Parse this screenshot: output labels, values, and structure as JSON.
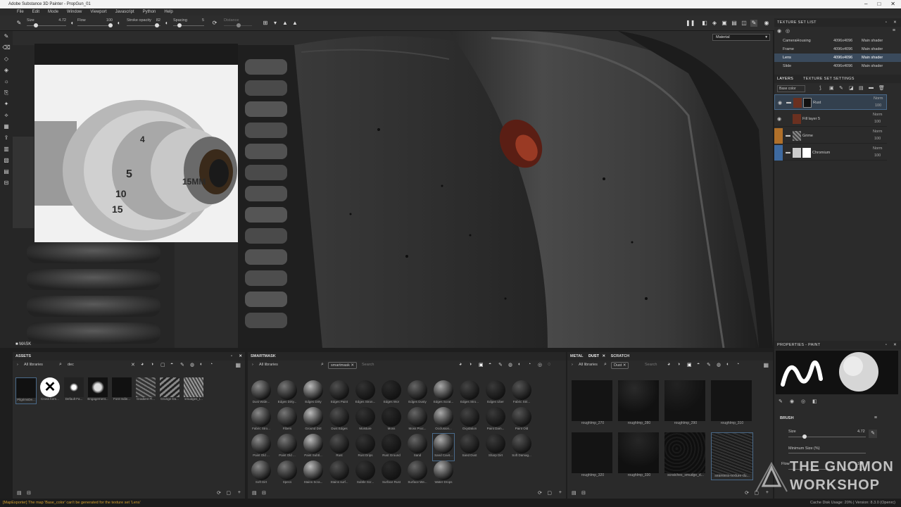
{
  "window": {
    "title": "Adobe Substance 3D Painter - PropGun_01"
  },
  "menu": [
    "File",
    "Edit",
    "Mode",
    "Window",
    "Viewport",
    "Javascript",
    "Python",
    "Help"
  ],
  "toolbar": {
    "size_label": "Size",
    "size_value": "4.72",
    "flow_label": "Flow",
    "flow_value": "100",
    "stroke_opacity_label": "Stroke opacity",
    "stroke_opacity_value": "82",
    "spacing_label": "Spacing",
    "spacing_value": "5",
    "distance_label": "Distance"
  },
  "viewport": {
    "material_mode": "Material",
    "mask_label": "MASK"
  },
  "texture_set_list": {
    "title": "TEXTURE SET LIST",
    "rows": [
      {
        "name": "CameraHousing",
        "res": "4096x4096",
        "shader": "Main shader"
      },
      {
        "name": "Frame",
        "res": "4096x4096",
        "shader": "Main shader"
      },
      {
        "name": "Lens",
        "res": "4096x4096",
        "shader": "Main shader"
      },
      {
        "name": "Slide",
        "res": "4096x4096",
        "shader": "Main shader"
      }
    ]
  },
  "layers": {
    "tab1": "LAYERS",
    "tab2": "TEXTURE SET SETTINGS",
    "channel": "Base color",
    "rows": [
      {
        "name": "Rust",
        "blend": "Norm",
        "opacity": "100"
      },
      {
        "name": "Fill layer 5",
        "blend": "Norm",
        "opacity": "100"
      },
      {
        "name": "Grime",
        "blend": "Norm",
        "opacity": "100"
      },
      {
        "name": "Chromium",
        "blend": "Norm",
        "opacity": "100"
      }
    ]
  },
  "assets": {
    "title": "ASSETS",
    "libraries": "All libraries",
    "search": "dec",
    "items": [
      "PilgrimsDe...",
      "Cross form...",
      "Default Fa...",
      "Engagement...",
      "Font Indie...",
      "Gradient Fl...",
      "Grunge Da...",
      "smudges_t..."
    ]
  },
  "smartmask": {
    "title": "SMARTMASK",
    "libraries": "All libraries",
    "tag": "smartmask",
    "search_placeholder": "Search",
    "items": [
      "Dust Wide...",
      "Edges Dirty...",
      "Edges Dirty",
      "Edges Paint",
      "Edges Stron...",
      "Edges Wor",
      "Edges Dusty",
      "Edges Scrat...",
      "Edges Stro...",
      "Edges Uber",
      "Fabric Stri...",
      "Fabric Stro...",
      "Fibers",
      "Ground Dirt",
      "Dust Edges",
      "Moisture",
      "Moss",
      "Moss Proc...",
      "Occlusion...",
      "Oxydation",
      "Paint Dam...",
      "Paint Old",
      "Paint Old ...",
      "Paint Old ...",
      "Paint Subtl...",
      "Rust",
      "Rust Drips",
      "Rust Ground",
      "Sand",
      "Sand Cavit...",
      "Sand Dust",
      "Sharp Dirt",
      "Soft Damag...",
      "Soft Dirt",
      "Specs",
      "Stains Scra...",
      "Stains surf...",
      "Subtle Scr...",
      "Surface Rust",
      "Surface We...",
      "Water Drops"
    ]
  },
  "dust": {
    "tabs": [
      "METAL",
      "DUST",
      "SCRATCH"
    ],
    "libraries": "All libraries",
    "tag": "Dust",
    "search_placeholder": "Search",
    "items": [
      "roughImp_270",
      "roughImp_280",
      "roughImp_290",
      "roughImp_310",
      "roughImp_320",
      "roughImp_330",
      "scratches_smudge_d...",
      "seamless-texture-du..."
    ]
  },
  "properties": {
    "title": "PROPERTIES - PAINT",
    "brush_section": "BRUSH",
    "size_label": "Size",
    "size_value": "4.72",
    "min_size_label": "Minimum Size (%)",
    "flow_label": "Flow",
    "flow_value": "100"
  },
  "status": {
    "message": "[MapExporter] The map 'Base_color' can't be generated for the texture set 'Lens'",
    "right": "Cache Disk Usage: 20%  |  Version: 8.3.0 (Openrc)"
  },
  "watermark": {
    "line1": "THE GNOMON",
    "line2": "WORKSHOP"
  },
  "colors": {
    "accent": "#3e6aa0",
    "selection": "#3a4a5c",
    "status_warning": "#d4a030"
  }
}
